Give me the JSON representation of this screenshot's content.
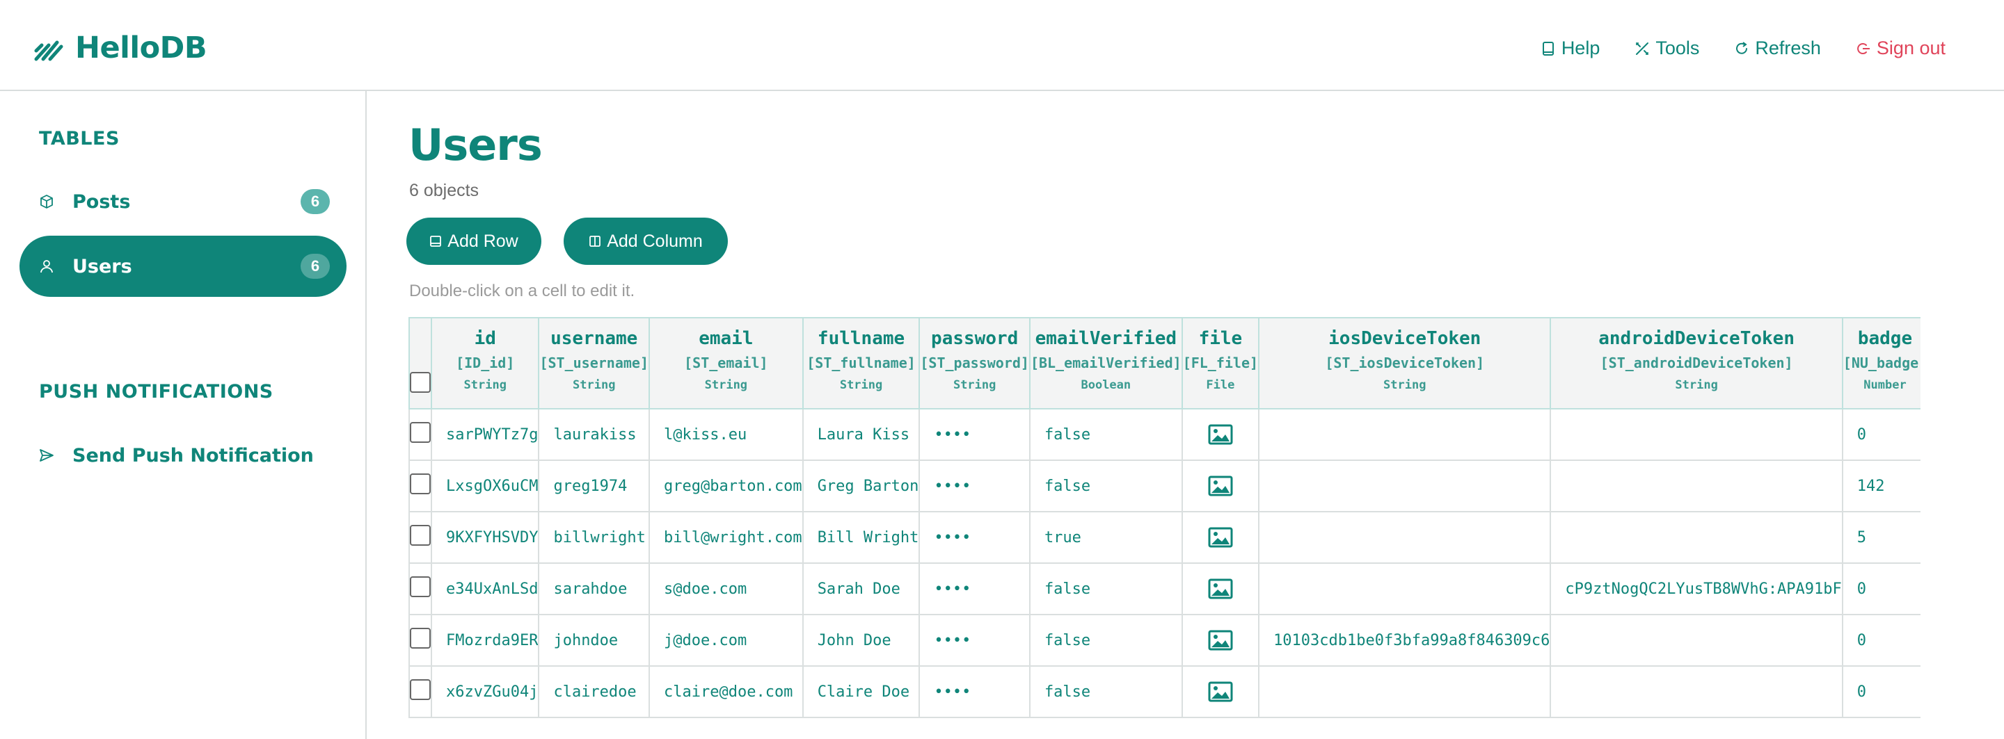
{
  "app": {
    "name": "HelloDB"
  },
  "nav": {
    "help": "Help",
    "tools": "Tools",
    "refresh": "Refresh",
    "signout": "Sign out"
  },
  "sidebar": {
    "tables_heading": "TABLES",
    "items": [
      {
        "label": "Posts",
        "count": "6",
        "icon": "cube-icon"
      },
      {
        "label": "Users",
        "count": "6",
        "icon": "user-icon"
      }
    ],
    "push_heading": "PUSH NOTIFICATIONS",
    "push_item": "Send Push Notification"
  },
  "main": {
    "title": "Users",
    "count_text": "6 objects",
    "add_row": "Add Row",
    "add_column": "Add Column",
    "hint": "Double-click on a cell to edit it."
  },
  "table": {
    "columns": [
      {
        "name": "id",
        "code": "[ID_id]",
        "type": "String"
      },
      {
        "name": "username",
        "code": "[ST_username]",
        "type": "String"
      },
      {
        "name": "email",
        "code": "[ST_email]",
        "type": "String"
      },
      {
        "name": "fullname",
        "code": "[ST_fullname]",
        "type": "String"
      },
      {
        "name": "password",
        "code": "[ST_password]",
        "type": "String"
      },
      {
        "name": "emailVerified",
        "code": "[BL_emailVerified]",
        "type": "Boolean"
      },
      {
        "name": "file",
        "code": "[FL_file]",
        "type": "File"
      },
      {
        "name": "iosDeviceToken",
        "code": "[ST_iosDeviceToken]",
        "type": "String"
      },
      {
        "name": "androidDeviceToken",
        "code": "[ST_androidDeviceToken]",
        "type": "String"
      },
      {
        "name": "badge",
        "code": "[NU_badge]",
        "type": "Number"
      }
    ],
    "rows": [
      {
        "id": "sarPWYTz7g",
        "username": "laurakiss",
        "email": "l@kiss.eu",
        "fullname": "Laura Kiss",
        "password": "••••",
        "emailVerified": "false",
        "iosDeviceToken": "",
        "androidDeviceToken": "",
        "badge": "0"
      },
      {
        "id": "LxsgOX6uCM",
        "username": "greg1974",
        "email": "greg@barton.com",
        "fullname": "Greg Barton",
        "password": "••••",
        "emailVerified": "false",
        "iosDeviceToken": "",
        "androidDeviceToken": "",
        "badge": "142"
      },
      {
        "id": "9KXFYHSVDY",
        "username": "billwright",
        "email": "bill@wright.com",
        "fullname": "Bill Wright",
        "password": "••••",
        "emailVerified": "true",
        "iosDeviceToken": "",
        "androidDeviceToken": "",
        "badge": "5"
      },
      {
        "id": "e34UxAnLSd",
        "username": "sarahdoe",
        "email": "s@doe.com",
        "fullname": "Sarah Doe",
        "password": "••••",
        "emailVerified": "false",
        "iosDeviceToken": "",
        "androidDeviceToken": "cP9ztNogQC2LYusTB8WVhG:APA91bF",
        "badge": "0"
      },
      {
        "id": "FMozrda9ER",
        "username": "johndoe",
        "email": "j@doe.com",
        "fullname": "John Doe",
        "password": "••••",
        "emailVerified": "false",
        "iosDeviceToken": "10103cdb1be0f3bfa99a8f846309c6",
        "androidDeviceToken": "",
        "badge": "0"
      },
      {
        "id": "x6zvZGu04j",
        "username": "clairedoe",
        "email": "claire@doe.com",
        "fullname": "Claire Doe",
        "password": "••••",
        "emailVerified": "false",
        "iosDeviceToken": "",
        "androidDeviceToken": "",
        "badge": "0"
      }
    ]
  },
  "colors": {
    "accent": "#0f8579",
    "signout": "#e0445a",
    "badge": "#5bb5ad"
  }
}
